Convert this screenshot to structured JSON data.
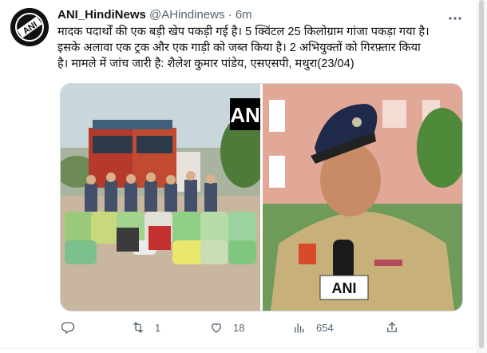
{
  "author": {
    "name": "ANI_HindiNews",
    "handle": "@AHindinews",
    "separator": "·",
    "time": "6m",
    "avatar_text": "ANI"
  },
  "tweet": {
    "lines": [
      "मादक पदार्थों की एक बड़ी खेप पकड़ी गई है। 5 क्विंटल 25 किलोग्राम गांजा पकड़ा गया है।",
      "इसके अलावा एक ट्रक और एक गाड़ी को जब्त किया है। 2 अभियुक्तों को गिरफ़्तार किया",
      "है। मामले में जांच जारी है: शैलेश कुमार पांडेय, एसएसपी, मथुरा(23/04)"
    ]
  },
  "media": {
    "left_watermark": "AN",
    "right_logo": "ANI"
  },
  "actions": {
    "reply": {
      "icon": "reply-icon",
      "count": ""
    },
    "retweet": {
      "icon": "retweet-icon",
      "count": "1"
    },
    "like": {
      "icon": "heart-icon",
      "count": "18"
    },
    "views": {
      "icon": "views-icon",
      "count": "654"
    },
    "share": {
      "icon": "share-icon",
      "count": ""
    }
  },
  "colors": {
    "text": "#0f1419",
    "secondary": "#536471",
    "divider": "#eff3f4"
  }
}
